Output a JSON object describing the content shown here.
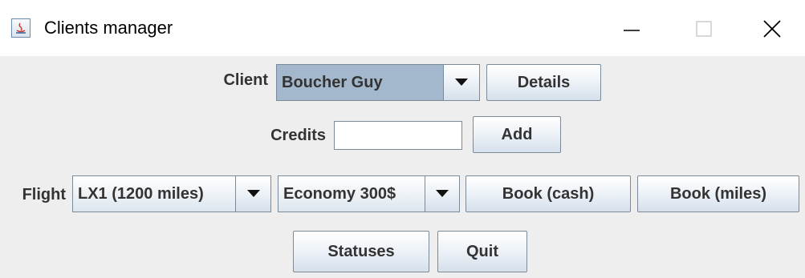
{
  "window": {
    "title": "Clients manager",
    "controls": {
      "minimize_icon": "minimize-icon",
      "maximize_icon": "maximize-icon",
      "close_icon": "close-icon"
    }
  },
  "client_row": {
    "label": "Client",
    "client_select": {
      "value": "Boucher Guy"
    },
    "details_button": "Details"
  },
  "credits_row": {
    "label": "Credits",
    "credits_input": {
      "value": "",
      "placeholder": ""
    },
    "add_button": "Add"
  },
  "flight_row": {
    "label": "Flight",
    "flight_select": {
      "value": "LX1 (1200 miles)"
    },
    "fare_select": {
      "value": "Economy 300$"
    },
    "book_cash_button": "Book (cash)",
    "book_miles_button": "Book (miles)"
  },
  "bottom_row": {
    "statuses_button": "Statuses",
    "quit_button": "Quit"
  },
  "colors": {
    "panel_background": "#eeeeee",
    "titlebar_background": "#ffffff",
    "selected_combo_background": "#a3b8cc",
    "text": "#333333",
    "border": "#7a8a99"
  }
}
